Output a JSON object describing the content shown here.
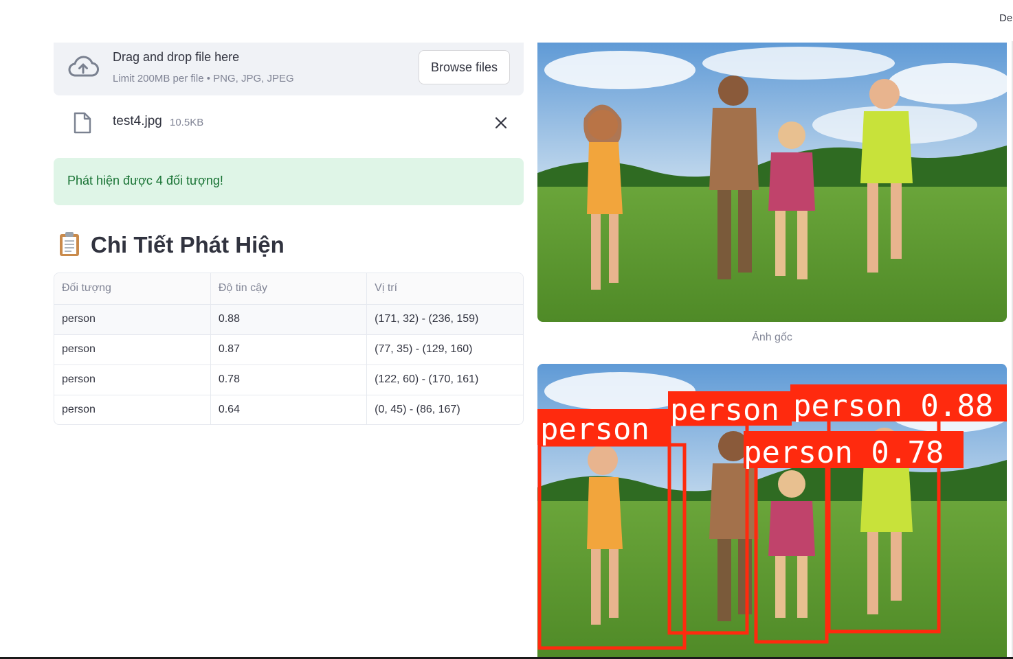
{
  "header": {
    "deploy_label": "Deploy"
  },
  "uploader": {
    "title": "Drag and drop file here",
    "limit": "Limit 200MB per file • PNG, JPG, JPEG",
    "browse_label": "Browse files",
    "file": {
      "name": "test4.jpg",
      "size": "10.5KB"
    }
  },
  "alert": {
    "text": "Phát hiện được 4 đối tượng!"
  },
  "section": {
    "icon": "clipboard-icon",
    "title": "Chi Tiết Phát Hiện"
  },
  "table": {
    "headers": [
      "Đối tượng",
      "Độ tin cậy",
      "Vị trí"
    ],
    "rows": [
      [
        "person",
        "0.88",
        "(171, 32) - (236, 159)"
      ],
      [
        "person",
        "0.87",
        "(77, 35) - (129, 160)"
      ],
      [
        "person",
        "0.78",
        "(122, 60) - (170, 161)"
      ],
      [
        "person",
        "0.64",
        "(0, 45) - (86, 167)"
      ]
    ]
  },
  "images": {
    "original_caption": "Ảnh gốc",
    "detections": [
      {
        "label": "person",
        "score": "0.88"
      },
      {
        "label": "person",
        "score": "0.87"
      },
      {
        "label": "person",
        "score": "0.78"
      },
      {
        "label": "person",
        "score": "0.64"
      }
    ],
    "box_label_text": [
      "person",
      "person",
      "person 0.88",
      "person 0.78"
    ],
    "box_color": "#ff2a0e"
  },
  "colors": {
    "success_bg": "#dff5e7",
    "success_text": "#177233",
    "dropzone_bg": "#f0f2f6"
  }
}
